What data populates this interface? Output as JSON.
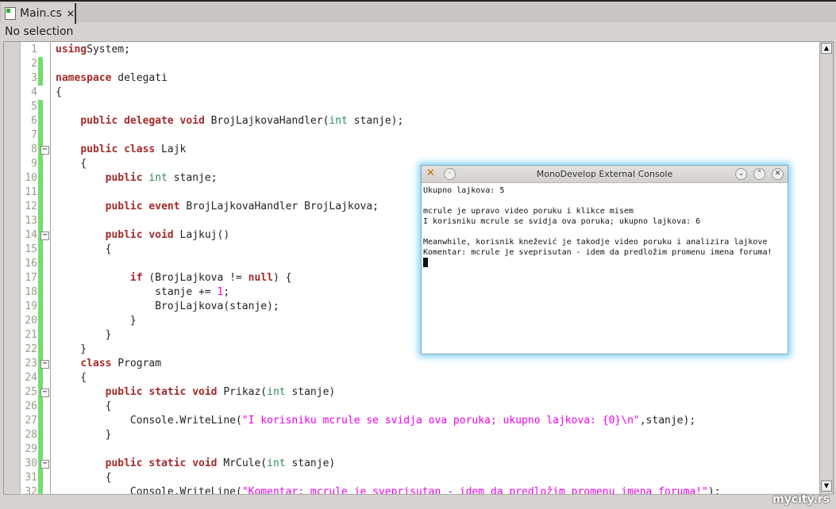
{
  "tab": {
    "label": "Main.cs",
    "icon": "csharp-file-icon",
    "close": "×"
  },
  "status": "No selection",
  "colors": {
    "keyword": "#a52a2a",
    "type": "#2e8b57",
    "string": "#ee00ee",
    "changed": "#6fe06a"
  },
  "code": {
    "changed_lines": [
      2,
      3,
      5,
      6,
      7,
      8,
      9,
      10,
      11,
      12,
      13,
      14,
      15,
      16,
      17,
      18,
      19,
      20,
      21,
      22,
      23,
      24,
      25,
      26,
      27,
      28,
      29,
      30,
      31,
      32
    ],
    "fold_lines": [
      8,
      14,
      23,
      25,
      30
    ],
    "lines": [
      [
        [
          "kw",
          "using"
        ],
        [
          "",
          "System;"
        ]
      ],
      [],
      [
        [
          "kw",
          "namespace"
        ],
        [
          "",
          " delegati"
        ]
      ],
      [
        [
          "",
          "{"
        ]
      ],
      [],
      [
        [
          "",
          "    "
        ],
        [
          "kw",
          "public delegate void"
        ],
        [
          "",
          " BrojLajkovaHandler("
        ],
        [
          "ty",
          "int"
        ],
        [
          "",
          " stanje);"
        ]
      ],
      [],
      [
        [
          "",
          "    "
        ],
        [
          "kw",
          "public class"
        ],
        [
          "",
          " Lajk"
        ]
      ],
      [
        [
          "",
          "    {"
        ]
      ],
      [
        [
          "",
          "        "
        ],
        [
          "kw",
          "public"
        ],
        [
          "",
          " "
        ],
        [
          "ty",
          "int"
        ],
        [
          "",
          " stanje;"
        ]
      ],
      [],
      [
        [
          "",
          "        "
        ],
        [
          "kw",
          "public event"
        ],
        [
          "",
          " BrojLajkovaHandler BrojLajkova;"
        ]
      ],
      [],
      [
        [
          "",
          "        "
        ],
        [
          "kw",
          "public void"
        ],
        [
          "",
          " Lajkuj()"
        ]
      ],
      [
        [
          "",
          "        {"
        ]
      ],
      [],
      [
        [
          "",
          "            "
        ],
        [
          "kw",
          "if"
        ],
        [
          "",
          " (BrojLajkova != "
        ],
        [
          "kw",
          "null"
        ],
        [
          "",
          ") {"
        ]
      ],
      [
        [
          "",
          "                stanje += "
        ],
        [
          "nu",
          "1"
        ],
        [
          "",
          ";"
        ]
      ],
      [
        [
          "",
          "                BrojLajkova(stanje);"
        ]
      ],
      [
        [
          "",
          "            }"
        ]
      ],
      [
        [
          "",
          "        }"
        ]
      ],
      [
        [
          "",
          "    }"
        ]
      ],
      [
        [
          "",
          "    "
        ],
        [
          "kw",
          "class"
        ],
        [
          "",
          " Program"
        ]
      ],
      [
        [
          "",
          "    {"
        ]
      ],
      [
        [
          "",
          "        "
        ],
        [
          "kw",
          "public static void"
        ],
        [
          "",
          " Prikaz("
        ],
        [
          "ty",
          "int"
        ],
        [
          "",
          " stanje)"
        ]
      ],
      [
        [
          "",
          "        {"
        ]
      ],
      [
        [
          "",
          "            Console.WriteLine("
        ],
        [
          "st",
          "\"I korisniku mcrule se svidja ova poruka; ukupno lajkova: {0}\\n\""
        ],
        [
          "",
          ",stanje);"
        ]
      ],
      [
        [
          "",
          "        }"
        ]
      ],
      [],
      [
        [
          "",
          "        "
        ],
        [
          "kw",
          "public static void"
        ],
        [
          "",
          " MrCule("
        ],
        [
          "ty",
          "int"
        ],
        [
          "",
          " stanje)"
        ]
      ],
      [
        [
          "",
          "        {"
        ]
      ],
      [
        [
          "",
          "            Console.WriteLine("
        ],
        [
          "st",
          "\"Komentar: mcrule je sveprisutan - idem da predložim promenu imena foruma!\""
        ],
        [
          "",
          ");"
        ]
      ]
    ]
  },
  "console": {
    "title": "MonoDevelop External Console",
    "lines": [
      "Ukupno lajkova: 5",
      "",
      "mcrule je upravo video poruku i klikce misem",
      "I korisniku mcrule se svidja ova poruka; ukupno lajkova: 6",
      "",
      "Meanwhile, korisnik knežević je takodje video poruku i analizira lajkove",
      "Komentar: mcrule je sveprisutan - idem da predložim promenu imena foruma!"
    ]
  },
  "watermark": "mycity.rs"
}
